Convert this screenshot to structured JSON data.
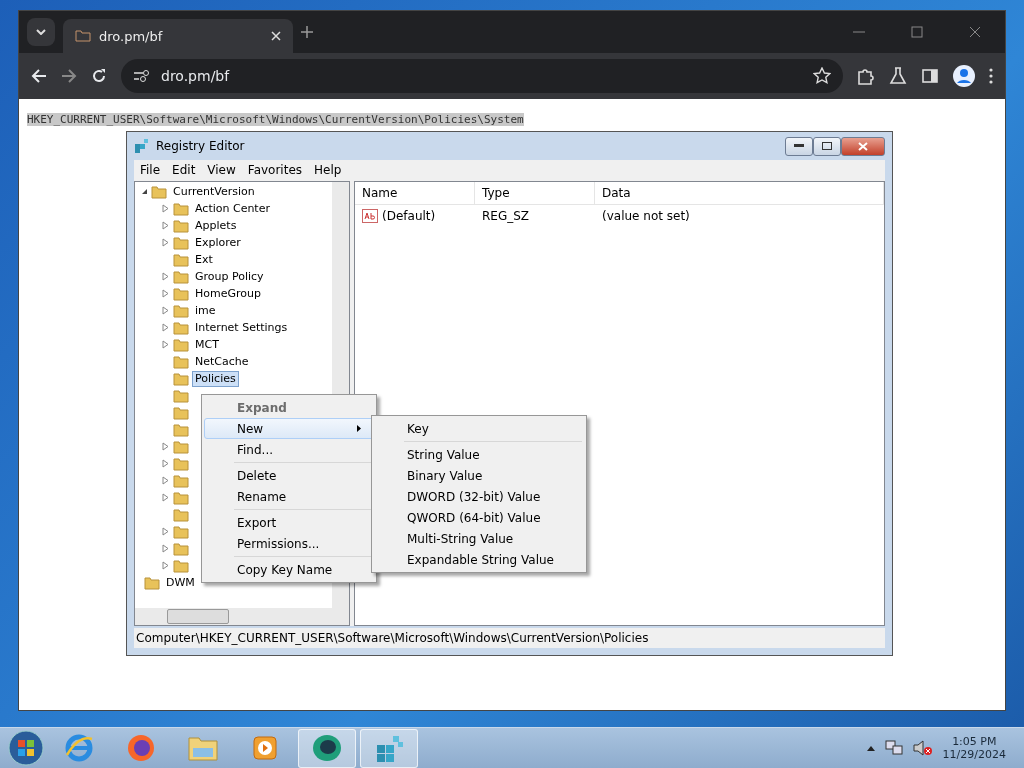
{
  "browser": {
    "tab_title": "dro.pm/bf",
    "address": "dro.pm/bf"
  },
  "page": {
    "path_text": "HKEY_CURRENT_USER\\Software\\Microsoft\\Windows\\CurrentVersion\\Policies\\System"
  },
  "regedit": {
    "title": "Registry Editor",
    "menu": [
      "File",
      "Edit",
      "View",
      "Favorites",
      "Help"
    ],
    "tree": {
      "label": "CurrentVersion",
      "expanded": true,
      "children": [
        {
          "label": "Action Center",
          "expander": true,
          "selected": false
        },
        {
          "label": "Applets",
          "expander": true,
          "selected": false
        },
        {
          "label": "Explorer",
          "expander": true,
          "selected": false
        },
        {
          "label": "Ext",
          "expander": false,
          "selected": false
        },
        {
          "label": "Group Policy",
          "expander": true,
          "selected": false
        },
        {
          "label": "HomeGroup",
          "expander": true,
          "selected": false
        },
        {
          "label": "ime",
          "expander": true,
          "selected": false
        },
        {
          "label": "Internet Settings",
          "expander": true,
          "selected": false
        },
        {
          "label": "MCT",
          "expander": true,
          "selected": false
        },
        {
          "label": "NetCache",
          "expander": false,
          "selected": false
        },
        {
          "label": "Policies",
          "expander": false,
          "selected": true
        },
        {
          "expander": false,
          "selected": false
        },
        {
          "expander": false,
          "selected": false
        },
        {
          "expander": false,
          "selected": false
        },
        {
          "expander": true,
          "selected": false
        },
        {
          "expander": true,
          "selected": false
        },
        {
          "expander": true,
          "selected": false
        },
        {
          "expander": true,
          "selected": false
        },
        {
          "expander": false,
          "selected": false
        },
        {
          "expander": true,
          "selected": false
        },
        {
          "expander": true,
          "selected": false
        },
        {
          "expander": true,
          "selected": false
        }
      ]
    },
    "tree_after": "DWM",
    "columns": [
      "Name",
      "Type",
      "Data"
    ],
    "values": [
      {
        "name": "(Default)",
        "type": "REG_SZ",
        "data": "(value not set)"
      }
    ],
    "status": "Computer\\HKEY_CURRENT_USER\\Software\\Microsoft\\Windows\\CurrentVersion\\Policies"
  },
  "context_menu": [
    {
      "kind": "item",
      "label": "Expand",
      "disabled": true,
      "selected": false,
      "submenu": false
    },
    {
      "kind": "item",
      "label": "New",
      "disabled": false,
      "selected": true,
      "submenu": true
    },
    {
      "kind": "item",
      "label": "Find...",
      "disabled": false,
      "selected": false,
      "submenu": false
    },
    {
      "kind": "separator"
    },
    {
      "kind": "item",
      "label": "Delete",
      "disabled": false,
      "selected": false,
      "submenu": false
    },
    {
      "kind": "item",
      "label": "Rename",
      "disabled": false,
      "selected": false,
      "submenu": false
    },
    {
      "kind": "separator"
    },
    {
      "kind": "item",
      "label": "Export",
      "disabled": false,
      "selected": false,
      "submenu": false
    },
    {
      "kind": "item",
      "label": "Permissions...",
      "disabled": false,
      "selected": false,
      "submenu": false
    },
    {
      "kind": "separator"
    },
    {
      "kind": "item",
      "label": "Copy Key Name",
      "disabled": false,
      "selected": false,
      "submenu": false
    }
  ],
  "submenu": [
    {
      "kind": "item",
      "label": "Key"
    },
    {
      "kind": "separator"
    },
    {
      "kind": "item",
      "label": "String Value"
    },
    {
      "kind": "item",
      "label": "Binary Value"
    },
    {
      "kind": "item",
      "label": "DWORD (32-bit) Value"
    },
    {
      "kind": "item",
      "label": "QWORD (64-bit) Value"
    },
    {
      "kind": "item",
      "label": "Multi-String Value"
    },
    {
      "kind": "item",
      "label": "Expandable String Value"
    }
  ],
  "taskbar": {
    "apps": [
      {
        "kind": "ie",
        "active": false
      },
      {
        "kind": "firefox",
        "active": false
      },
      {
        "kind": "explorer",
        "active": false
      },
      {
        "kind": "media",
        "active": false
      },
      {
        "kind": "app",
        "active": true
      },
      {
        "kind": "regedit",
        "active": true
      }
    ],
    "time": "1:05 PM",
    "date": "11/29/2024"
  }
}
